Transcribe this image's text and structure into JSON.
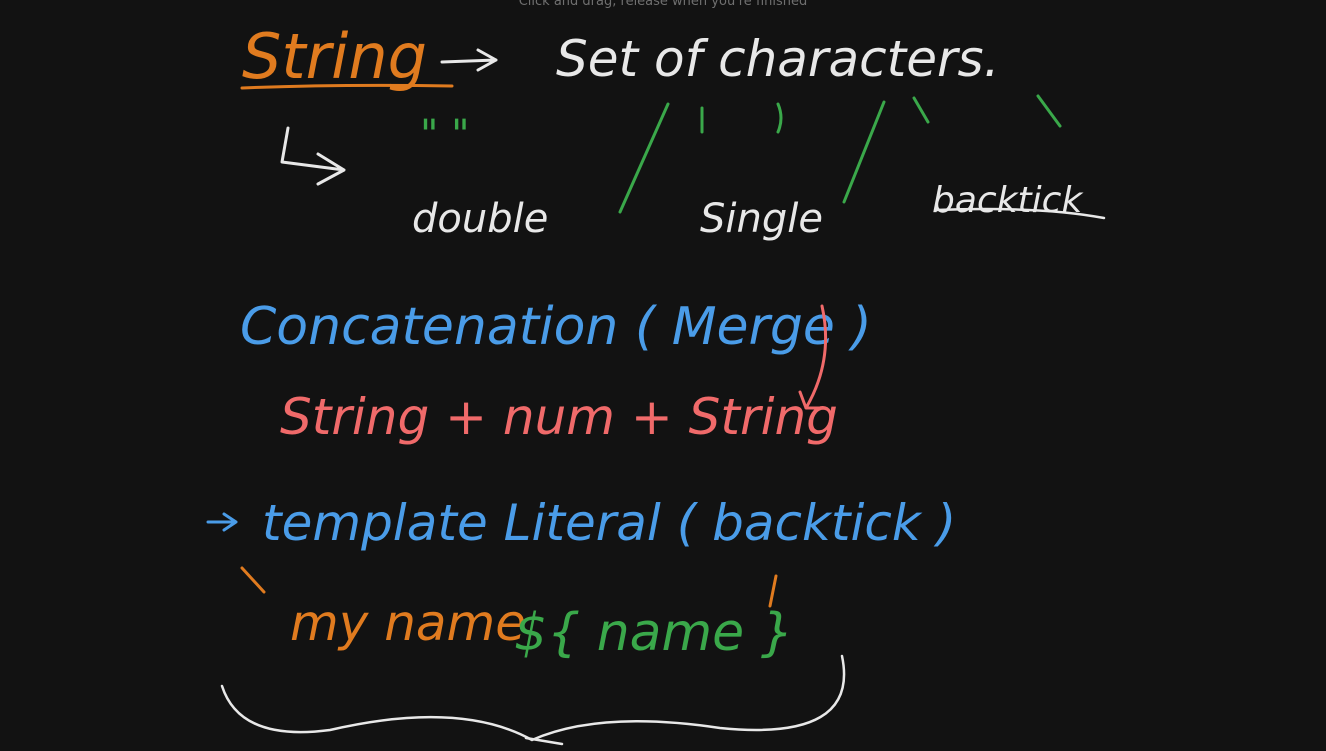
{
  "hint": "Click and drag, release when you're finished",
  "colors": {
    "background": "#121212",
    "orange": "#e07b1f",
    "white": "#e8e8e8",
    "green": "#3aa84a",
    "blue": "#4a9ce8",
    "red": "#f06a6a"
  },
  "notes": {
    "string_heading": "String",
    "set_of_characters": "Set of characters.",
    "quote_double_mark": "\"  \"",
    "quote_single_mark": "'   '",
    "quote_backtick_mark": "`   `",
    "label_double": "double",
    "label_single": "Single",
    "label_backtick": "backtick",
    "concatenation": "Concatenation ( Merge )",
    "string_plus": "String + num + String",
    "template_literal": "template Literal ( backtick )",
    "my_name": "my name",
    "placeholder": "${ name }"
  }
}
